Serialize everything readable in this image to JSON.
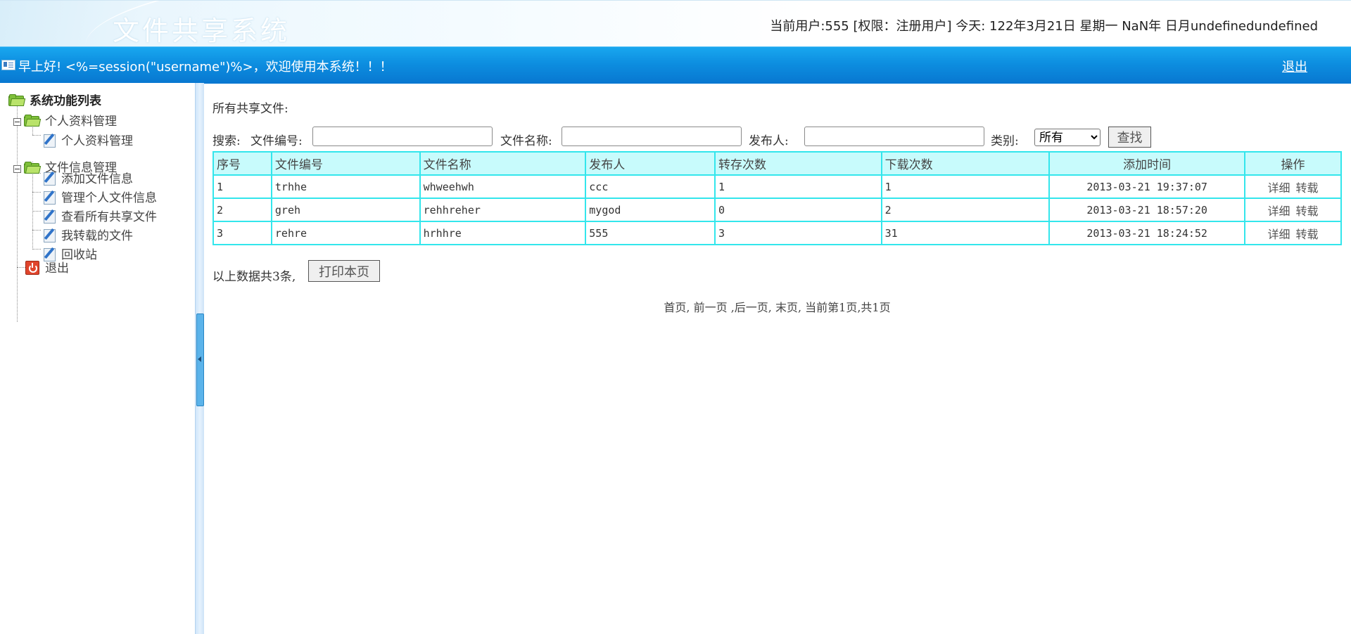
{
  "header": {
    "app_title": "文件共享系统",
    "user_info": "当前用户:555 [权限：注册用户] 今天:   122年3月21日 星期一 NaN年 日月undefinedundefined"
  },
  "bluebar": {
    "greeting": "早上好! <%=session(\"username\")%>，欢迎使用本系统！！！",
    "logout": "退出"
  },
  "sidebar": {
    "root": "系统功能列表",
    "groups": [
      {
        "label": "个人资料管理",
        "items": [
          "个人资料管理"
        ]
      },
      {
        "label": "文件信息管理",
        "items": [
          "添加文件信息",
          "管理个人文件信息",
          "查看所有共享文件",
          "我转载的文件",
          "回收站"
        ]
      }
    ],
    "exit": "退出"
  },
  "main": {
    "section_title": "所有共享文件:",
    "search": {
      "prefix": "搜索:",
      "file_no_label": "文件编号:",
      "file_no_value": "",
      "file_name_label": "文件名称:",
      "file_name_value": "",
      "publisher_label": "发布人:",
      "publisher_value": "",
      "category_label": "类别:",
      "category_selected": "所有",
      "search_button": "查找"
    },
    "table": {
      "headers": [
        "序号",
        "文件编号",
        "文件名称",
        "发布人",
        "转存次数",
        "下载次数",
        "添加时间",
        "操作"
      ],
      "rows": [
        {
          "no": "1",
          "file_no": "trhhe",
          "file_name": "whweehwh",
          "publisher": "ccc",
          "saved": "1",
          "downloads": "1",
          "added": "2013-03-21 19:37:07",
          "op_detail": "详细",
          "op_save": "转载"
        },
        {
          "no": "2",
          "file_no": "greh",
          "file_name": "rehhreher",
          "publisher": "mygod",
          "saved": "0",
          "downloads": "2",
          "added": "2013-03-21 18:57:20",
          "op_detail": "详细",
          "op_save": "转载"
        },
        {
          "no": "3",
          "file_no": "rehre",
          "file_name": "hrhhre",
          "publisher": "555",
          "saved": "3",
          "downloads": "31",
          "added": "2013-03-21 18:24:52",
          "op_detail": "详细",
          "op_save": "转载"
        }
      ]
    },
    "summary": "以上数据共3条,",
    "print_button": "打印本页",
    "pager": {
      "first": "首页,",
      "prev": "前一页",
      "next": ",后一页,",
      "last": "末页,",
      "status": "当前第1页,共1页"
    }
  }
}
